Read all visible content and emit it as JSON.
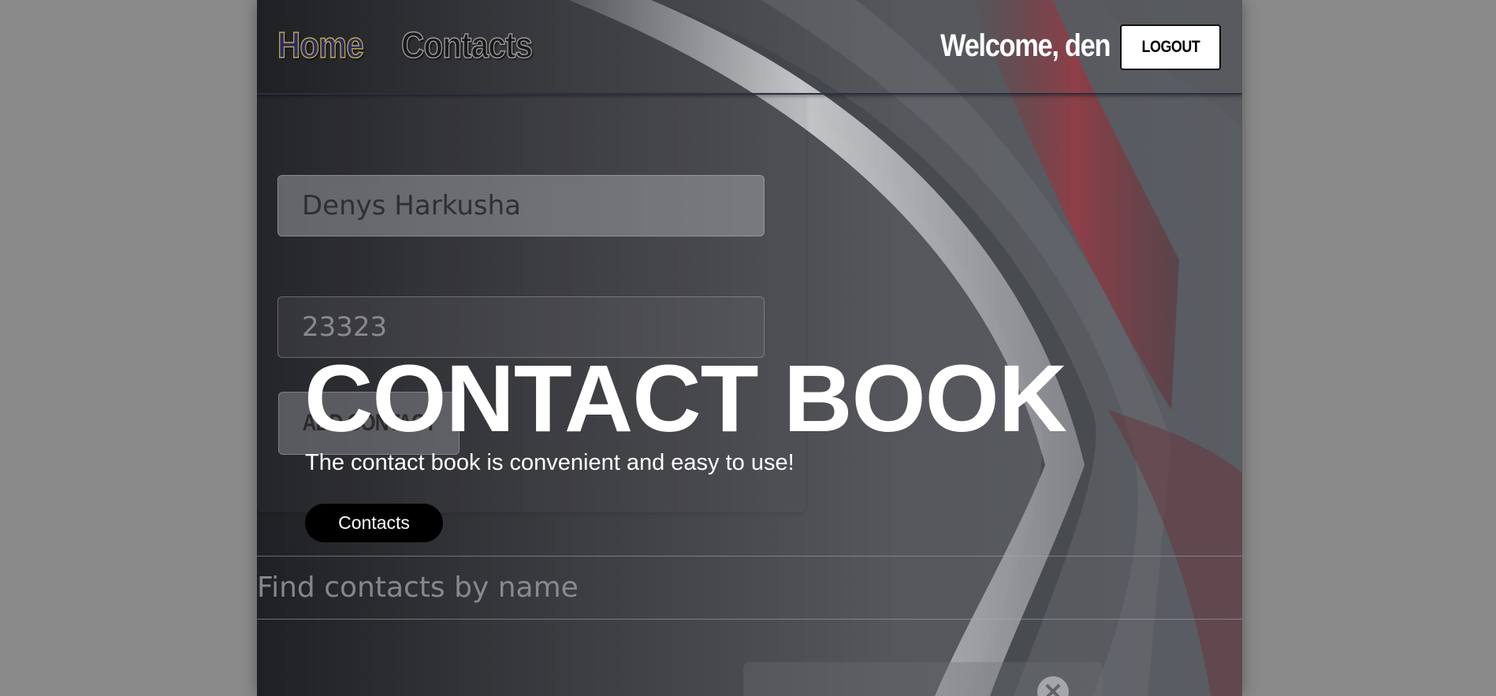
{
  "header": {
    "nav_home": "Home",
    "nav_contacts": "Contacts",
    "welcome": "Welcome, den",
    "logout_label": "LOGOUT"
  },
  "form": {
    "name_value": "Denys Harkusha",
    "number_value": "23323",
    "add_label": "ADD CONTACT"
  },
  "filter": {
    "placeholder": "Find contacts by name"
  },
  "hero": {
    "title": "CONTACT BOOK",
    "subtitle": "The contact book is convenient and easy to use!",
    "button_label": "Contacts"
  },
  "contact_card": {
    "delete_icon": "close-icon"
  },
  "colors": {
    "page_background": "#8a8a8a",
    "hero_text": "#ffffff",
    "hero_button_bg": "#000000",
    "logout_bg": "#ffffff",
    "accent_red": "#a8323c"
  }
}
